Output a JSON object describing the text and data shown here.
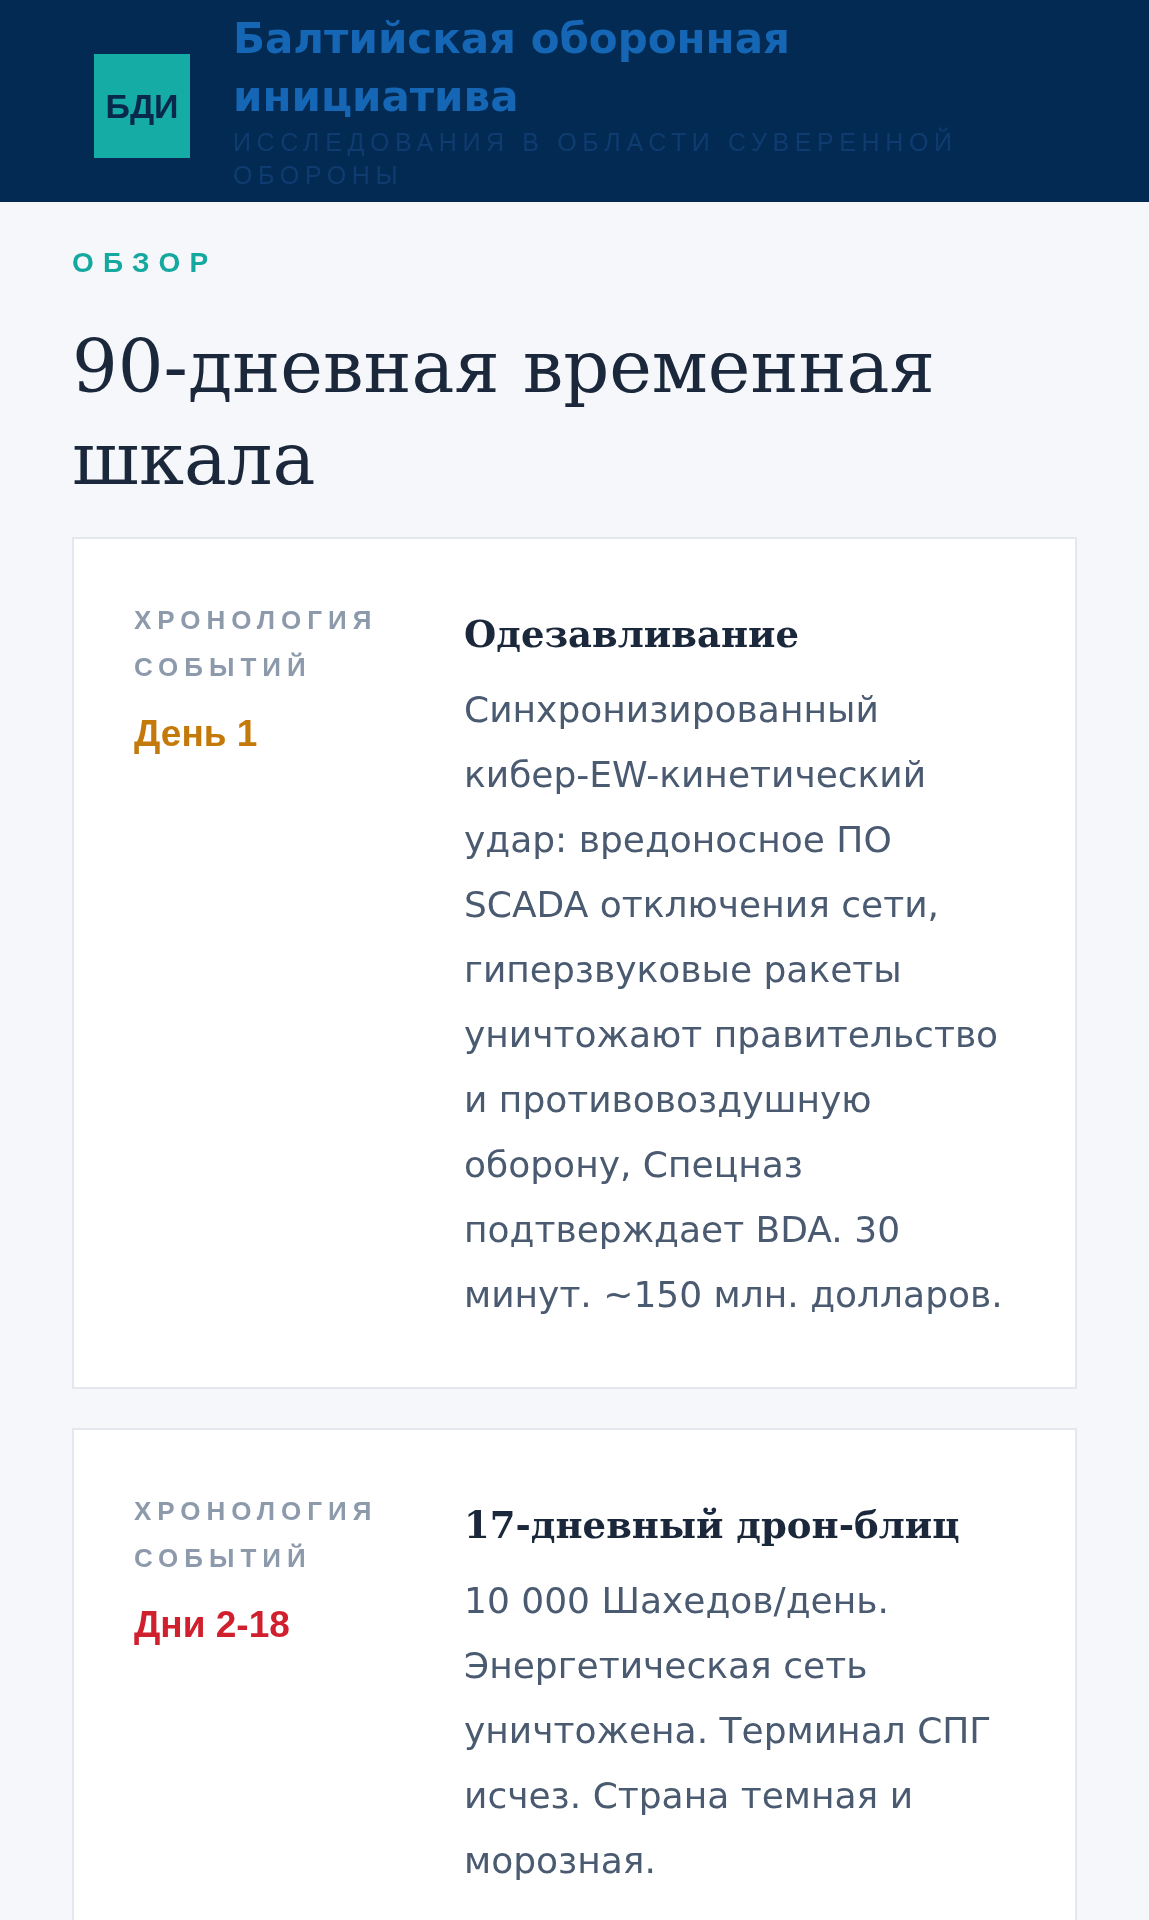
{
  "header": {
    "logo": "БДИ",
    "title": "Балтийская оборонная инициатива",
    "subtitle": "ИССЛЕДОВАНИЯ В ОБЛАСТИ СУВЕРЕННОЙ ОБОРОНЫ"
  },
  "section": {
    "eyebrow": "ОБЗОР",
    "title": "90-дневная временная шкала"
  },
  "timeline": [
    {
      "label": "ХРОНОЛОГИЯ СОБЫТИЙ",
      "period": "День 1",
      "color": "#c47a0a",
      "title": "Одезавливание",
      "text": "Синхронизированный кибер-EW-кинетический удар: вредоносное ПО SCADA отключения сети, гиперзвуковые ракеты уничтожают правительство и противовоздушную оборону, Спецназ подтверждает BDA. 30 минут. ~150 млн. долларов."
    },
    {
      "label": "ХРОНОЛОГИЯ СОБЫТИЙ",
      "period": "Дни 2-18",
      "color": "#d0202e",
      "title": "17-дневный дрон-блиц",
      "text": "10 000 Шахедов/день. Энергетическая сеть уничтожена. Терминал СПГ исчез. Страна темная и морозная."
    }
  ]
}
